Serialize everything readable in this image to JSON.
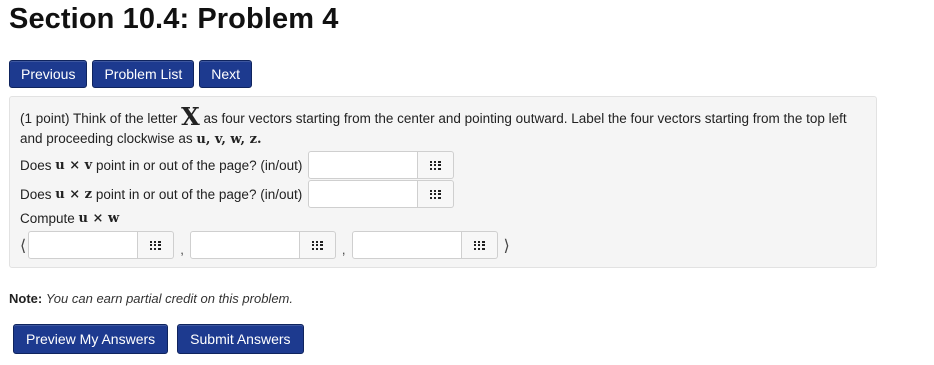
{
  "page_title": "Section 10.4: Problem 4",
  "nav": {
    "previous_label": "Previous",
    "problem_list_label": "Problem List",
    "next_label": "Next"
  },
  "problem": {
    "points": "(1 point)",
    "text_part1": "Think of the letter",
    "big_letter": "X",
    "text_part2": "as four vectors starting from the center and pointing outward. Label the four vectors starting from the top left and proceeding clockwise as",
    "vector_labels": "u, v, w, z.",
    "q1": {
      "prefix": "Does",
      "expr": "u × v",
      "suffix": "point in or out of the page? (in/out)",
      "value": ""
    },
    "q2": {
      "prefix": "Does",
      "expr": "u × z",
      "suffix": "point in or out of the page? (in/out)",
      "value": ""
    },
    "q3": {
      "prefix": "Compute",
      "expr": "u × w"
    },
    "vector_open": "⟨",
    "vector_close": "⟩",
    "comma": ",",
    "components": [
      "",
      "",
      ""
    ]
  },
  "note": {
    "label": "Note:",
    "text": "You can earn partial credit on this problem."
  },
  "actions": {
    "preview_label": "Preview My Answers",
    "submit_label": "Submit Answers"
  },
  "colors": {
    "button_bg": "#1d3a8f",
    "panel_bg": "#f5f5f5"
  },
  "icons": {
    "answer_palette": "grid-icon"
  }
}
